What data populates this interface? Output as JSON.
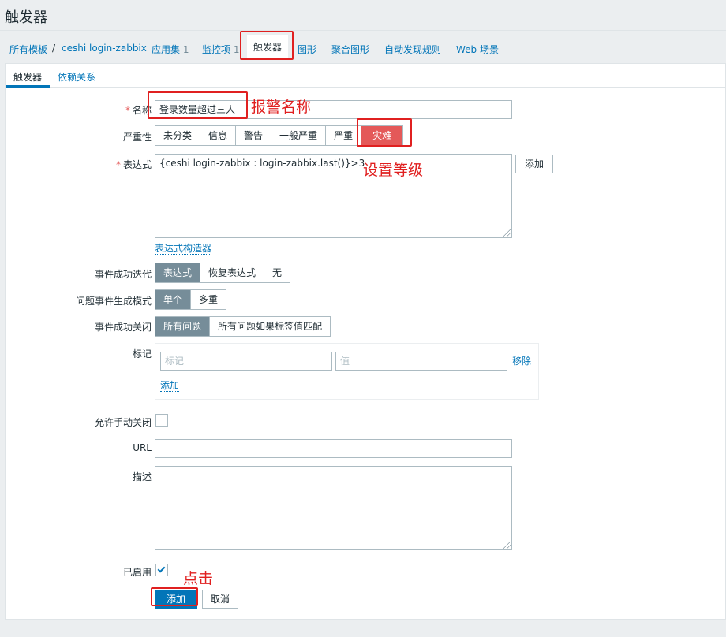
{
  "page": {
    "title": "触发器"
  },
  "breadcrumbs": {
    "all_templates": "所有模板",
    "separator": "/",
    "template": "ceshi login-zabbix",
    "applications": "应用集",
    "applications_count": "1",
    "items": "监控项",
    "items_count": "1",
    "triggers": "触发器",
    "graphs": "图形",
    "screens": "聚合图形",
    "discovery": "自动发现规则",
    "web": "Web 场景"
  },
  "tabs": {
    "trigger": "触发器",
    "dependencies": "依赖关系"
  },
  "form": {
    "required_mark": "*",
    "name_label": "名称",
    "name_value": "登录数量超过三人",
    "severity_label": "严重性",
    "severity_options": [
      "未分类",
      "信息",
      "警告",
      "一般严重",
      "严重",
      "灾难"
    ],
    "expression_label": "表达式",
    "expression_value": "{ceshi login-zabbix : login-zabbix.last()}>3",
    "expression_add": "添加",
    "expression_builder": "表达式构造器",
    "ok_event_label": "事件成功迭代",
    "ok_event_options": [
      "表达式",
      "恢复表达式",
      "无"
    ],
    "problem_mode_label": "问题事件生成模式",
    "problem_mode_options": [
      "单个",
      "多重"
    ],
    "ok_close_label": "事件成功关闭",
    "ok_close_options": [
      "所有问题",
      "所有问题如果标签值匹配"
    ],
    "tags_label": "标记",
    "tag_placeholder": "标记",
    "value_placeholder": "值",
    "tag_remove": "移除",
    "tag_add": "添加",
    "manual_close_label": "允许手动关闭",
    "url_label": "URL",
    "description_label": "描述",
    "enabled_label": "已启用",
    "submit": "添加",
    "cancel": "取消"
  },
  "annotations": {
    "name_note": "报警名称",
    "severity_note": "设置等级",
    "click_note": "点击"
  },
  "colors": {
    "link": "#0275b8",
    "disaster": "#e45959",
    "selected": "#768d99",
    "annotation": "#e02020"
  }
}
